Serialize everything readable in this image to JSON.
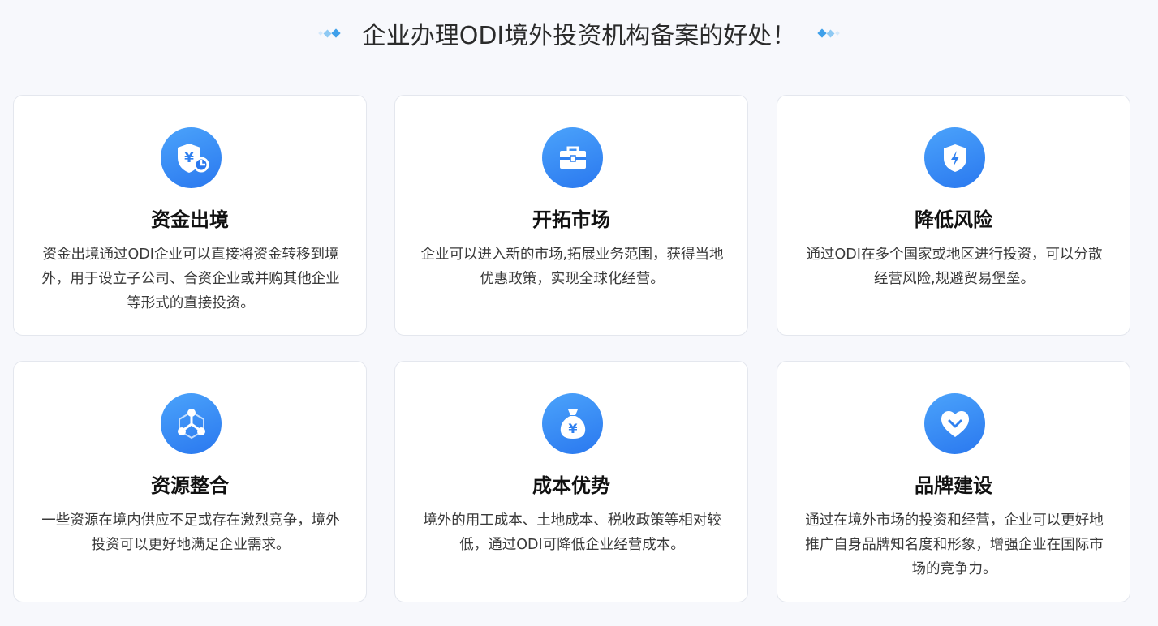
{
  "page": {
    "title": "企业办理ODI境外投资机构备案的好处！"
  },
  "colors": {
    "background": "#f7f8fc",
    "card": "#ffffff",
    "accent": "#2a78ef",
    "accent_light": "#4ba3fb"
  },
  "cards": [
    {
      "icon": "shield-yen-icon",
      "title": "资金出境",
      "desc": "资金出境通过ODI企业可以直接将资金转移到境外，用于设立子公司、合资企业或并购其他企业等形式的直接投资。"
    },
    {
      "icon": "briefcase-icon",
      "title": "开拓市场",
      "desc": "企业可以进入新的市场,拓展业务范围，获得当地优惠政策，实现全球化经营。"
    },
    {
      "icon": "shield-lightning-icon",
      "title": "降低风险",
      "desc": "通过ODI在多个国家或地区进行投资，可以分散经营风险,规避贸易堡垒。"
    },
    {
      "icon": "network-icon",
      "title": "资源整合",
      "desc": "一些资源在境内供应不足或存在激烈竞争，境外投资可以更好地满足企业需求。"
    },
    {
      "icon": "money-bag-icon",
      "title": "成本优势",
      "desc": "境外的用工成本、土地成本、税收政策等相对较低，通过ODI可降低企业经营成本。"
    },
    {
      "icon": "heart-badge-icon",
      "title": "品牌建设",
      "desc": "通过在境外市场的投资和经营，企业可以更好地推广自身品牌知名度和形象，增强企业在国际市场的竞争力。"
    }
  ]
}
